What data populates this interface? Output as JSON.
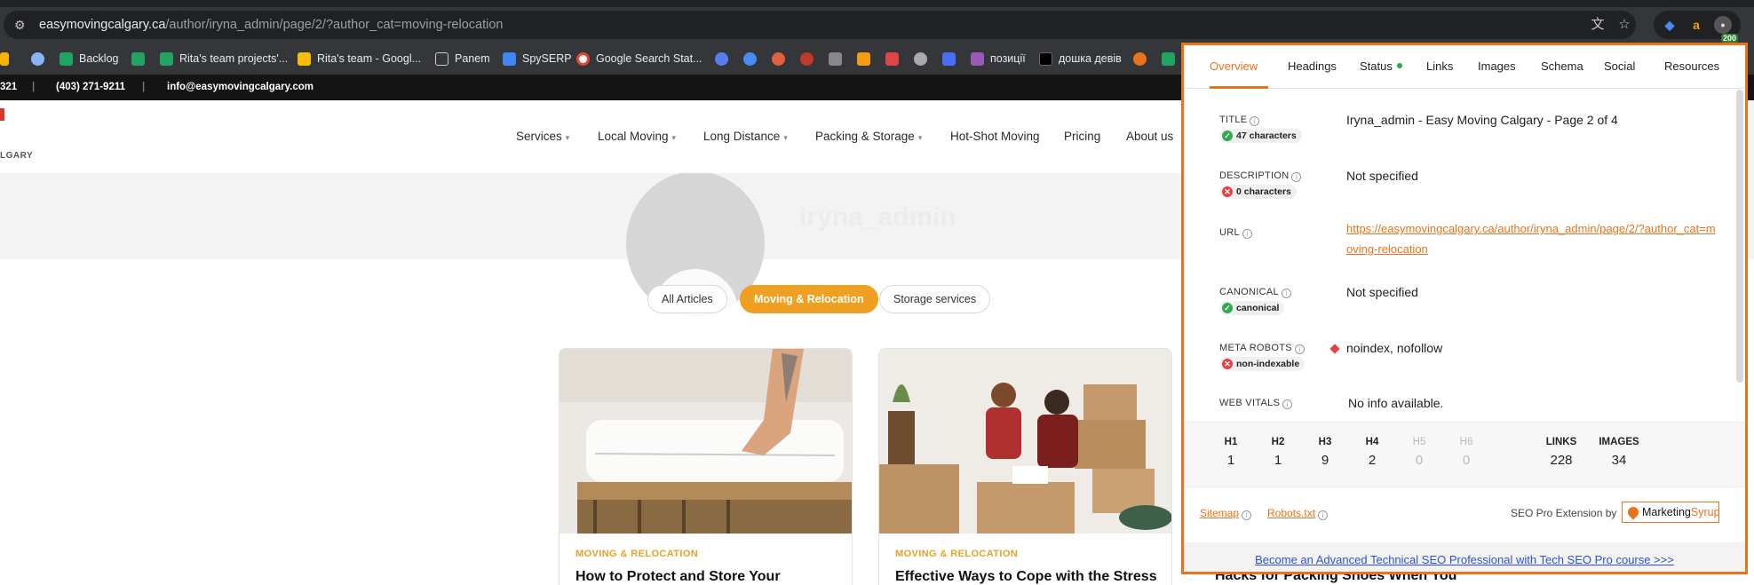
{
  "browser": {
    "url_host": "easymovingcalgary.ca",
    "url_path": "/author/iryna_admin/page/2/?author_cat=moving-relocation",
    "status_badge": "200"
  },
  "bookmarks": [
    {
      "label": "Backlog"
    },
    {
      "label": "Rita's team projects'..."
    },
    {
      "label": "Rita's team - Googl..."
    },
    {
      "label": "Panem"
    },
    {
      "label": "SpySERP"
    },
    {
      "label": "Google Search Stat..."
    },
    {
      "label": "позиції"
    },
    {
      "label": "дошка девів"
    }
  ],
  "site": {
    "contact": {
      "phone_partial": "321",
      "phone": "(403) 271-9211",
      "email": "info@easymovingcalgary.com"
    },
    "logo_partial": "LGARY",
    "author_name": "Iryna_admin",
    "nav": [
      "Services",
      "Local Moving",
      "Long Distance",
      "Packing & Storage",
      "Hot-Shot Moving",
      "Pricing",
      "About us"
    ],
    "filters": [
      "All Articles",
      "Moving & Relocation",
      "Storage services"
    ],
    "cards": [
      {
        "category": "MOVING & RELOCATION",
        "title": "How to Protect and Store Your"
      },
      {
        "category": "MOVING & RELOCATION",
        "title": "Effective Ways to Cope with the Stress"
      }
    ],
    "peek_title": "Hacks for Packing Shoes When You"
  },
  "seo_panel": {
    "tabs": [
      "Overview",
      "Headings",
      "Status",
      "Links",
      "Images",
      "Schema",
      "Social",
      "Resources"
    ],
    "title_label": "TITLE",
    "title_badge": "47 characters",
    "title_value": "Iryna_admin - Easy Moving Calgary - Page 2 of 4",
    "description_label": "DESCRIPTION",
    "description_badge": "0 characters",
    "description_value": "Not specified",
    "url_label": "URL",
    "url_value": "https://easymovingcalgary.ca/author/iryna_admin/page/2/?author_cat=moving-relocation",
    "canonical_label": "CANONICAL",
    "canonical_badge": "canonical",
    "canonical_value": "Not specified",
    "robots_label": "META ROBOTS",
    "robots_badge": "non-indexable",
    "robots_value": "noindex, nofollow",
    "vitals_label": "WEB VITALS",
    "vitals_value": "No info available.",
    "stats": [
      {
        "label": "H1",
        "value": "1"
      },
      {
        "label": "H2",
        "value": "1"
      },
      {
        "label": "H3",
        "value": "9"
      },
      {
        "label": "H4",
        "value": "2"
      },
      {
        "label": "H5",
        "value": "0"
      },
      {
        "label": "H6",
        "value": "0"
      },
      {
        "label": "LINKS",
        "value": "228"
      },
      {
        "label": "IMAGES",
        "value": "34"
      }
    ],
    "sitemap_link": "Sitemap",
    "robots_link": "Robots.txt",
    "by_text": "SEO Pro Extension by",
    "brand_a": "Marketing",
    "brand_b": "Syrup",
    "promo": "Become an Advanced Technical SEO Professional with Tech SEO Pro course >>>",
    "accent_color": "#e8731c"
  }
}
